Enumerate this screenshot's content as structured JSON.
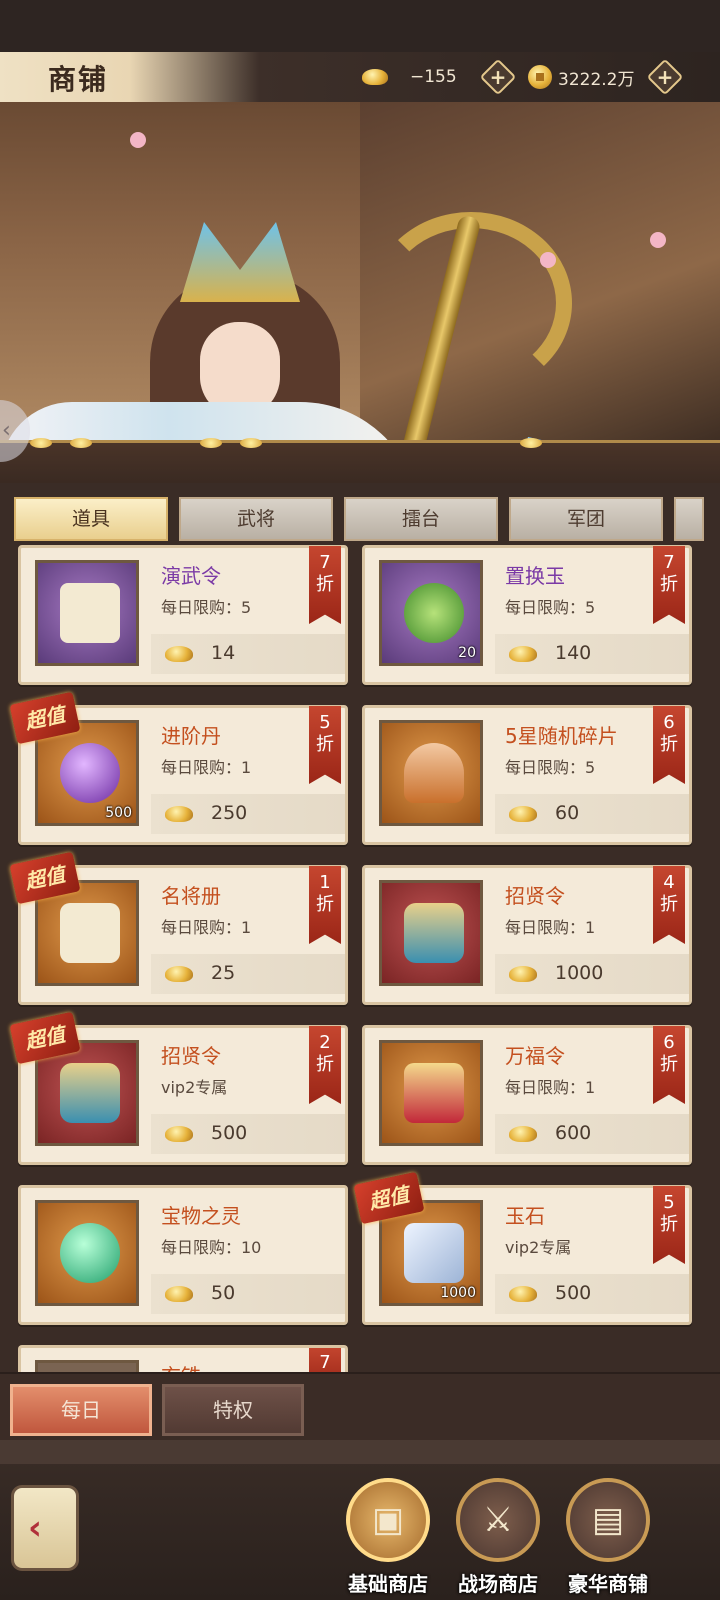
{
  "header": {
    "title": "商铺",
    "ingot_value": "−155",
    "coin_value": "3222.2万"
  },
  "tabs": [
    {
      "label": "道具"
    },
    {
      "label": "武将"
    },
    {
      "label": "擂台"
    },
    {
      "label": "军团"
    }
  ],
  "items": [
    {
      "name": "演武令",
      "limit": "每日限购：5",
      "price": "14",
      "discount": "7\n折"
    },
    {
      "name": "置换玉",
      "limit": "每日限购：5",
      "price": "140",
      "discount": "7\n折",
      "qty": "20"
    },
    {
      "name": "进阶丹",
      "limit": "每日限购：1",
      "price": "250",
      "discount": "5\n折",
      "qty": "500",
      "super": "超值"
    },
    {
      "name": "5星随机碎片",
      "limit": "每日限购：5",
      "price": "60",
      "discount": "6\n折"
    },
    {
      "name": "名将册",
      "limit": "每日限购：1",
      "price": "25",
      "discount": "1\n折",
      "super": "超值"
    },
    {
      "name": "招贤令",
      "limit": "每日限购：1",
      "price": "1000",
      "discount": "4\n折"
    },
    {
      "name": "招贤令",
      "limit": "vip2专属",
      "price": "500",
      "discount": "2\n折",
      "super": "超值"
    },
    {
      "name": "万福令",
      "limit": "每日限购：1",
      "price": "600",
      "discount": "6\n折"
    },
    {
      "name": "宝物之灵",
      "limit": "每日限购：10",
      "price": "50",
      "discount": ""
    },
    {
      "name": "玉石",
      "limit": "vip2专属",
      "price": "500",
      "discount": "5\n折",
      "qty": "1000",
      "super": "超值"
    },
    {
      "name": "玄铁",
      "discount": "7"
    }
  ],
  "subtabs": [
    {
      "label": "每日"
    },
    {
      "label": "特权"
    }
  ],
  "bottom_nav": [
    {
      "label": "基础商店",
      "icon": "treasure-chest-icon"
    },
    {
      "label": "战场商店",
      "icon": "crossed-swords-icon"
    },
    {
      "label": "豪华商铺",
      "icon": "luxury-chest-icon"
    }
  ]
}
